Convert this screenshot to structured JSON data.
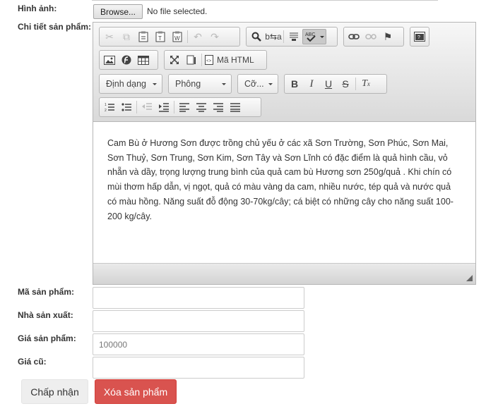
{
  "form": {
    "image_label": "Hình ảnh:",
    "browse_label": "Browse...",
    "no_file_text": "No file selected.",
    "detail_label": "Chi tiết sản phẩm:",
    "code_label": "Mã sản phẩm:",
    "code_value": "",
    "maker_label": "Nhà sản xuất:",
    "maker_value": "",
    "price_label": "Giá sản phẩm:",
    "price_value": "100000",
    "old_price_label": "Giá cũ:",
    "old_price_value": "",
    "accept_label": "Chấp nhận",
    "delete_label": "Xóa sản phẩm"
  },
  "editor": {
    "format_label": "Định dạng",
    "font_label": "Phông",
    "size_label": "Cỡ...",
    "source_label": "Mã HTML",
    "bold_glyph": "B",
    "italic_glyph": "I",
    "underline_glyph": "U",
    "strike_glyph": "S",
    "removeformat_glyph": "Tx",
    "content": "Cam Bù ở Hương Sơn được trồng chủ yếu ở các xã Sơn Trường, Sơn Phúc, Sơn Mai, Sơn Thuỷ, Sơn Trung, Sơn Kim, Sơn Tây và Sơn Lĩnh có đặc điểm là quả hình cầu, vỏ nhẵn và dầy, trọng lượng trung bình của quả cam bù Hương sơn 250g/quả . Khi chín có mùi thơm hấp dẫn, vị ngọt, quả có màu vàng da cam, nhiều nước, tép quả và nước quả có màu hồng. Năng suất đỗ động 30-70kg/cây; cá biệt có những cây cho năng suất 100-200 kg/cây."
  }
}
